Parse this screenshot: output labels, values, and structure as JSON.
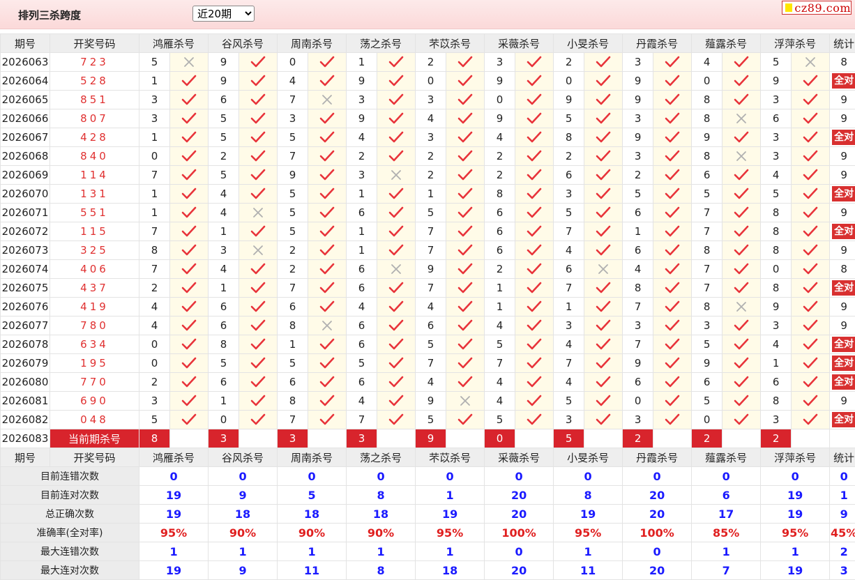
{
  "header": {
    "title": "排列三杀跨度",
    "period_select": "近20期",
    "logo_text": "cz89.com"
  },
  "columns": {
    "period": "期号",
    "draw": "开奖号码",
    "experts": [
      "鸿雁杀号",
      "谷风杀号",
      "周南杀号",
      "荡之杀号",
      "芣苡杀号",
      "采薇杀号",
      "小旻杀号",
      "丹霞杀号",
      "薤露杀号",
      "浮萍杀号"
    ],
    "stat": "统计"
  },
  "rows": [
    {
      "period": "2026063",
      "draw": "723",
      "kills": [
        5,
        9,
        0,
        1,
        2,
        3,
        2,
        3,
        4,
        5
      ],
      "ok": [
        0,
        1,
        1,
        1,
        1,
        1,
        1,
        1,
        1,
        0
      ],
      "total": "8"
    },
    {
      "period": "2026064",
      "draw": "528",
      "kills": [
        1,
        9,
        4,
        9,
        0,
        9,
        0,
        9,
        0,
        9
      ],
      "ok": [
        1,
        1,
        1,
        1,
        1,
        1,
        1,
        1,
        1,
        1
      ],
      "total": "全对"
    },
    {
      "period": "2026065",
      "draw": "851",
      "kills": [
        3,
        6,
        7,
        3,
        3,
        0,
        9,
        9,
        8,
        3
      ],
      "ok": [
        1,
        1,
        0,
        1,
        1,
        1,
        1,
        1,
        1,
        1
      ],
      "total": "9"
    },
    {
      "period": "2026066",
      "draw": "807",
      "kills": [
        3,
        5,
        3,
        9,
        4,
        9,
        5,
        3,
        8,
        6
      ],
      "ok": [
        1,
        1,
        1,
        1,
        1,
        1,
        1,
        1,
        0,
        1
      ],
      "total": "9"
    },
    {
      "period": "2026067",
      "draw": "428",
      "kills": [
        1,
        5,
        5,
        4,
        3,
        4,
        8,
        9,
        9,
        3
      ],
      "ok": [
        1,
        1,
        1,
        1,
        1,
        1,
        1,
        1,
        1,
        1
      ],
      "total": "全对"
    },
    {
      "period": "2026068",
      "draw": "840",
      "kills": [
        0,
        2,
        7,
        2,
        2,
        2,
        2,
        3,
        8,
        3
      ],
      "ok": [
        1,
        1,
        1,
        1,
        1,
        1,
        1,
        1,
        0,
        1
      ],
      "total": "9"
    },
    {
      "period": "2026069",
      "draw": "114",
      "kills": [
        7,
        5,
        9,
        3,
        2,
        2,
        6,
        2,
        6,
        4
      ],
      "ok": [
        1,
        1,
        1,
        0,
        1,
        1,
        1,
        1,
        1,
        1
      ],
      "total": "9"
    },
    {
      "period": "2026070",
      "draw": "131",
      "kills": [
        1,
        4,
        5,
        1,
        1,
        8,
        3,
        5,
        5,
        5
      ],
      "ok": [
        1,
        1,
        1,
        1,
        1,
        1,
        1,
        1,
        1,
        1
      ],
      "total": "全对"
    },
    {
      "period": "2026071",
      "draw": "551",
      "kills": [
        1,
        4,
        5,
        6,
        5,
        6,
        5,
        6,
        7,
        8
      ],
      "ok": [
        1,
        0,
        1,
        1,
        1,
        1,
        1,
        1,
        1,
        1
      ],
      "total": "9"
    },
    {
      "period": "2026072",
      "draw": "115",
      "kills": [
        7,
        1,
        5,
        1,
        7,
        6,
        7,
        1,
        7,
        8
      ],
      "ok": [
        1,
        1,
        1,
        1,
        1,
        1,
        1,
        1,
        1,
        1
      ],
      "total": "全对"
    },
    {
      "period": "2026073",
      "draw": "325",
      "kills": [
        8,
        3,
        2,
        1,
        7,
        6,
        4,
        6,
        8,
        8
      ],
      "ok": [
        1,
        0,
        1,
        1,
        1,
        1,
        1,
        1,
        1,
        1
      ],
      "total": "9"
    },
    {
      "period": "2026074",
      "draw": "406",
      "kills": [
        7,
        4,
        2,
        6,
        9,
        2,
        6,
        4,
        7,
        0
      ],
      "ok": [
        1,
        1,
        1,
        0,
        1,
        1,
        0,
        1,
        1,
        1
      ],
      "total": "8"
    },
    {
      "period": "2026075",
      "draw": "437",
      "kills": [
        2,
        1,
        7,
        6,
        7,
        1,
        7,
        8,
        7,
        8
      ],
      "ok": [
        1,
        1,
        1,
        1,
        1,
        1,
        1,
        1,
        1,
        1
      ],
      "total": "全对"
    },
    {
      "period": "2026076",
      "draw": "419",
      "kills": [
        4,
        6,
        6,
        4,
        4,
        1,
        1,
        7,
        8,
        9
      ],
      "ok": [
        1,
        1,
        1,
        1,
        1,
        1,
        1,
        1,
        0,
        1
      ],
      "total": "9"
    },
    {
      "period": "2026077",
      "draw": "780",
      "kills": [
        4,
        6,
        8,
        6,
        6,
        4,
        3,
        3,
        3,
        3
      ],
      "ok": [
        1,
        1,
        0,
        1,
        1,
        1,
        1,
        1,
        1,
        1
      ],
      "total": "9"
    },
    {
      "period": "2026078",
      "draw": "634",
      "kills": [
        0,
        8,
        1,
        6,
        5,
        5,
        4,
        7,
        5,
        4
      ],
      "ok": [
        1,
        1,
        1,
        1,
        1,
        1,
        1,
        1,
        1,
        1
      ],
      "total": "全对"
    },
    {
      "period": "2026079",
      "draw": "195",
      "kills": [
        0,
        5,
        5,
        5,
        7,
        7,
        7,
        9,
        9,
        1
      ],
      "ok": [
        1,
        1,
        1,
        1,
        1,
        1,
        1,
        1,
        1,
        1
      ],
      "total": "全对"
    },
    {
      "period": "2026080",
      "draw": "770",
      "kills": [
        2,
        6,
        6,
        6,
        4,
        4,
        4,
        6,
        6,
        6
      ],
      "ok": [
        1,
        1,
        1,
        1,
        1,
        1,
        1,
        1,
        1,
        1
      ],
      "total": "全对"
    },
    {
      "period": "2026081",
      "draw": "690",
      "kills": [
        3,
        1,
        8,
        4,
        9,
        4,
        5,
        0,
        5,
        8
      ],
      "ok": [
        1,
        1,
        1,
        1,
        0,
        1,
        1,
        1,
        1,
        1
      ],
      "total": "9"
    },
    {
      "period": "2026082",
      "draw": "048",
      "kills": [
        5,
        0,
        7,
        7,
        5,
        5,
        3,
        3,
        0,
        3
      ],
      "ok": [
        1,
        1,
        1,
        1,
        1,
        1,
        1,
        1,
        1,
        1
      ],
      "total": "全对"
    }
  ],
  "current": {
    "period": "2026083",
    "label": "当前期杀号",
    "kills": [
      "8",
      "3",
      "3",
      "3",
      "9",
      "0",
      "5",
      "2",
      "2",
      "2"
    ]
  },
  "stats": [
    {
      "label": "目前连错次数",
      "values": [
        "0",
        "0",
        "0",
        "0",
        "0",
        "0",
        "0",
        "0",
        "0",
        "0"
      ],
      "total": "0",
      "pct": false
    },
    {
      "label": "目前连对次数",
      "values": [
        "19",
        "9",
        "5",
        "8",
        "1",
        "20",
        "8",
        "20",
        "6",
        "19"
      ],
      "total": "1",
      "pct": false
    },
    {
      "label": "总正确次数",
      "values": [
        "19",
        "18",
        "18",
        "18",
        "19",
        "20",
        "19",
        "20",
        "17",
        "19"
      ],
      "total": "9",
      "pct": false
    },
    {
      "label": "准确率(全对率)",
      "values": [
        "95%",
        "90%",
        "90%",
        "90%",
        "95%",
        "100%",
        "95%",
        "100%",
        "85%",
        "95%"
      ],
      "total": "45%",
      "pct": true
    },
    {
      "label": "最大连错次数",
      "values": [
        "1",
        "1",
        "1",
        "1",
        "1",
        "0",
        "1",
        "0",
        "1",
        "1"
      ],
      "total": "2",
      "pct": false
    },
    {
      "label": "最大连对次数",
      "values": [
        "19",
        "9",
        "11",
        "8",
        "18",
        "20",
        "11",
        "20",
        "7",
        "19"
      ],
      "total": "3",
      "pct": false
    }
  ],
  "colors": {
    "check": "#e8333a",
    "cross": "#b0b0b0",
    "accent": "#d8242c",
    "stat_blue": "#1a1aff"
  }
}
